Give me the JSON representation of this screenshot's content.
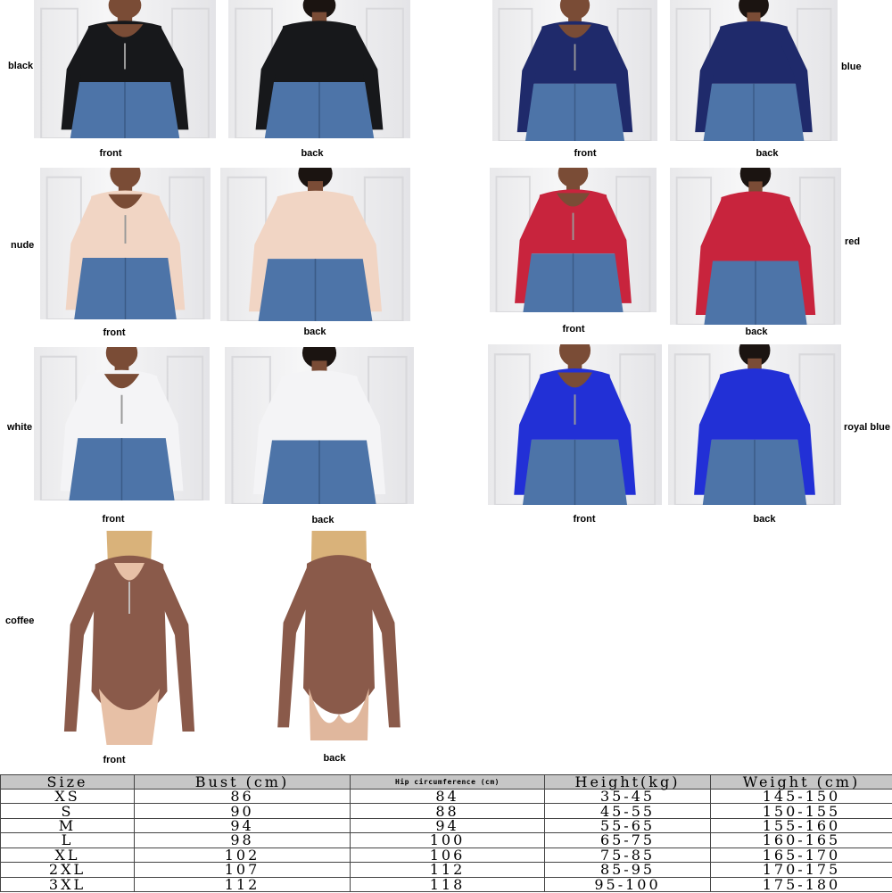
{
  "colors_map": {
    "black": "#17181b",
    "blue": "#1f2a6b",
    "nude": "#f1d5c4",
    "red": "#c8243d",
    "white": "#f4f4f6",
    "royal_blue": "#2230d6",
    "coffee": "#8a5a4a",
    "jeans": "#4d74a8",
    "skin": "#7a4c36",
    "hair_blonde": "#d9b27a"
  },
  "labels": {
    "black": "black",
    "blue": "blue",
    "nude": "nude",
    "red": "red",
    "white": "white",
    "royal_blue": "royal blue",
    "coffee": "coffee",
    "front": "front",
    "back": "back"
  },
  "table": {
    "headers": [
      "Size",
      "Bust (cm)",
      "Hip circumference (cm)",
      "Height(kg)",
      "Weight (cm)"
    ],
    "rows": [
      [
        "XS",
        "86",
        "84",
        "35-45",
        "145-150"
      ],
      [
        "S",
        "90",
        "88",
        "45-55",
        "150-155"
      ],
      [
        "M",
        "94",
        "94",
        "55-65",
        "155-160"
      ],
      [
        "L",
        "98",
        "100",
        "65-75",
        "160-165"
      ],
      [
        "XL",
        "102",
        "106",
        "75-85",
        "165-170"
      ],
      [
        "2XL",
        "107",
        "112",
        "85-95",
        "170-175"
      ],
      [
        "3XL",
        "112",
        "118",
        "95-100",
        "175-180"
      ]
    ]
  }
}
